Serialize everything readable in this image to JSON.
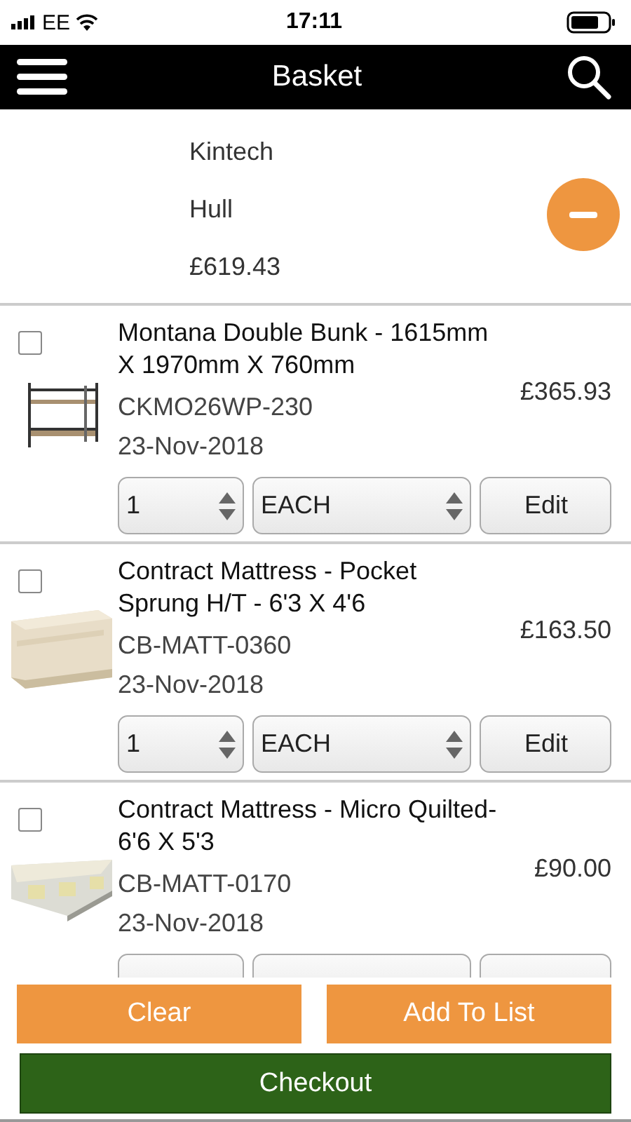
{
  "status_bar": {
    "carrier": "EE",
    "time": "17:11"
  },
  "header": {
    "title": "Basket"
  },
  "customer": {
    "name": "Kintech",
    "town": "Hull",
    "total": "£619.43"
  },
  "items": [
    {
      "checked": false,
      "title": "Montana Double Bunk - 1615mm X 1970mm X 760mm",
      "code": "CKMO26WP-230",
      "date": "23-Nov-2018",
      "price": "£365.93",
      "quantity": "1",
      "unit": "EACH",
      "edit": "Edit"
    },
    {
      "checked": false,
      "title": "Contract Mattress - Pocket Sprung H/T - 6'3 X 4'6",
      "code": "CB-MATT-0360",
      "date": "23-Nov-2018",
      "price": "£163.50",
      "quantity": "1",
      "unit": "EACH",
      "edit": "Edit"
    },
    {
      "checked": false,
      "title": "Contract Mattress - Micro Quilted- 6'6 X 5'3",
      "code": "CB-MATT-0170",
      "date": "23-Nov-2018",
      "price": "£90.00"
    }
  ],
  "buttons": {
    "clear": "Clear",
    "add_to_list": "Add To List",
    "checkout": "Checkout"
  }
}
